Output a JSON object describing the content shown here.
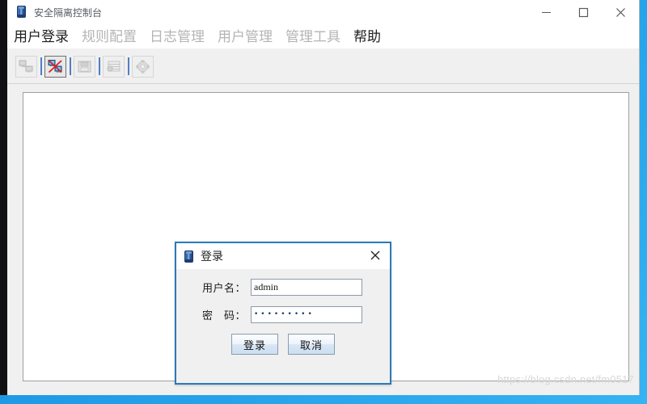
{
  "window": {
    "title": "安全隔离控制台",
    "icon": "blue-cylinder-icon",
    "controls": {
      "minimize": "minimize-icon",
      "maximize": "maximize-icon",
      "close": "close-icon"
    }
  },
  "menubar": {
    "items": [
      {
        "label": "用户登录",
        "enabled": true
      },
      {
        "label": "规则配置",
        "enabled": false
      },
      {
        "label": "日志管理",
        "enabled": false
      },
      {
        "label": "用户管理",
        "enabled": false
      },
      {
        "label": "管理工具",
        "enabled": false
      },
      {
        "label": "帮助",
        "enabled": true
      }
    ]
  },
  "toolbar": {
    "buttons": [
      {
        "name": "connect-icon",
        "active": false,
        "enabled": false
      },
      {
        "name": "disconnect-icon",
        "active": true,
        "enabled": true
      },
      {
        "name": "save-icon",
        "active": false,
        "enabled": false
      },
      {
        "name": "list-icon",
        "active": false,
        "enabled": false
      },
      {
        "name": "settings-gear-icon",
        "active": false,
        "enabled": false
      }
    ]
  },
  "dialog": {
    "title": "登录",
    "icon": "blue-cylinder-icon",
    "close_label": "✕",
    "fields": [
      {
        "label": "用户名：",
        "value": "admin",
        "placeholder": "",
        "type": "text"
      },
      {
        "label": "密　码：",
        "value": "•••••••••",
        "placeholder": "",
        "type": "password"
      }
    ],
    "buttons": [
      {
        "label": "登录",
        "primary": true
      },
      {
        "label": "取消",
        "primary": false
      }
    ]
  },
  "watermark": {
    "text": "https://blog.csdn.net/fm0517"
  },
  "colors": {
    "dialog_border": "#2a7ab9",
    "menu_enabled": "#1d1d1d",
    "menu_disabled": "#b4b4b4",
    "desktop": "#1f9ae6",
    "toolbar_separator": "#4f7fc4"
  }
}
